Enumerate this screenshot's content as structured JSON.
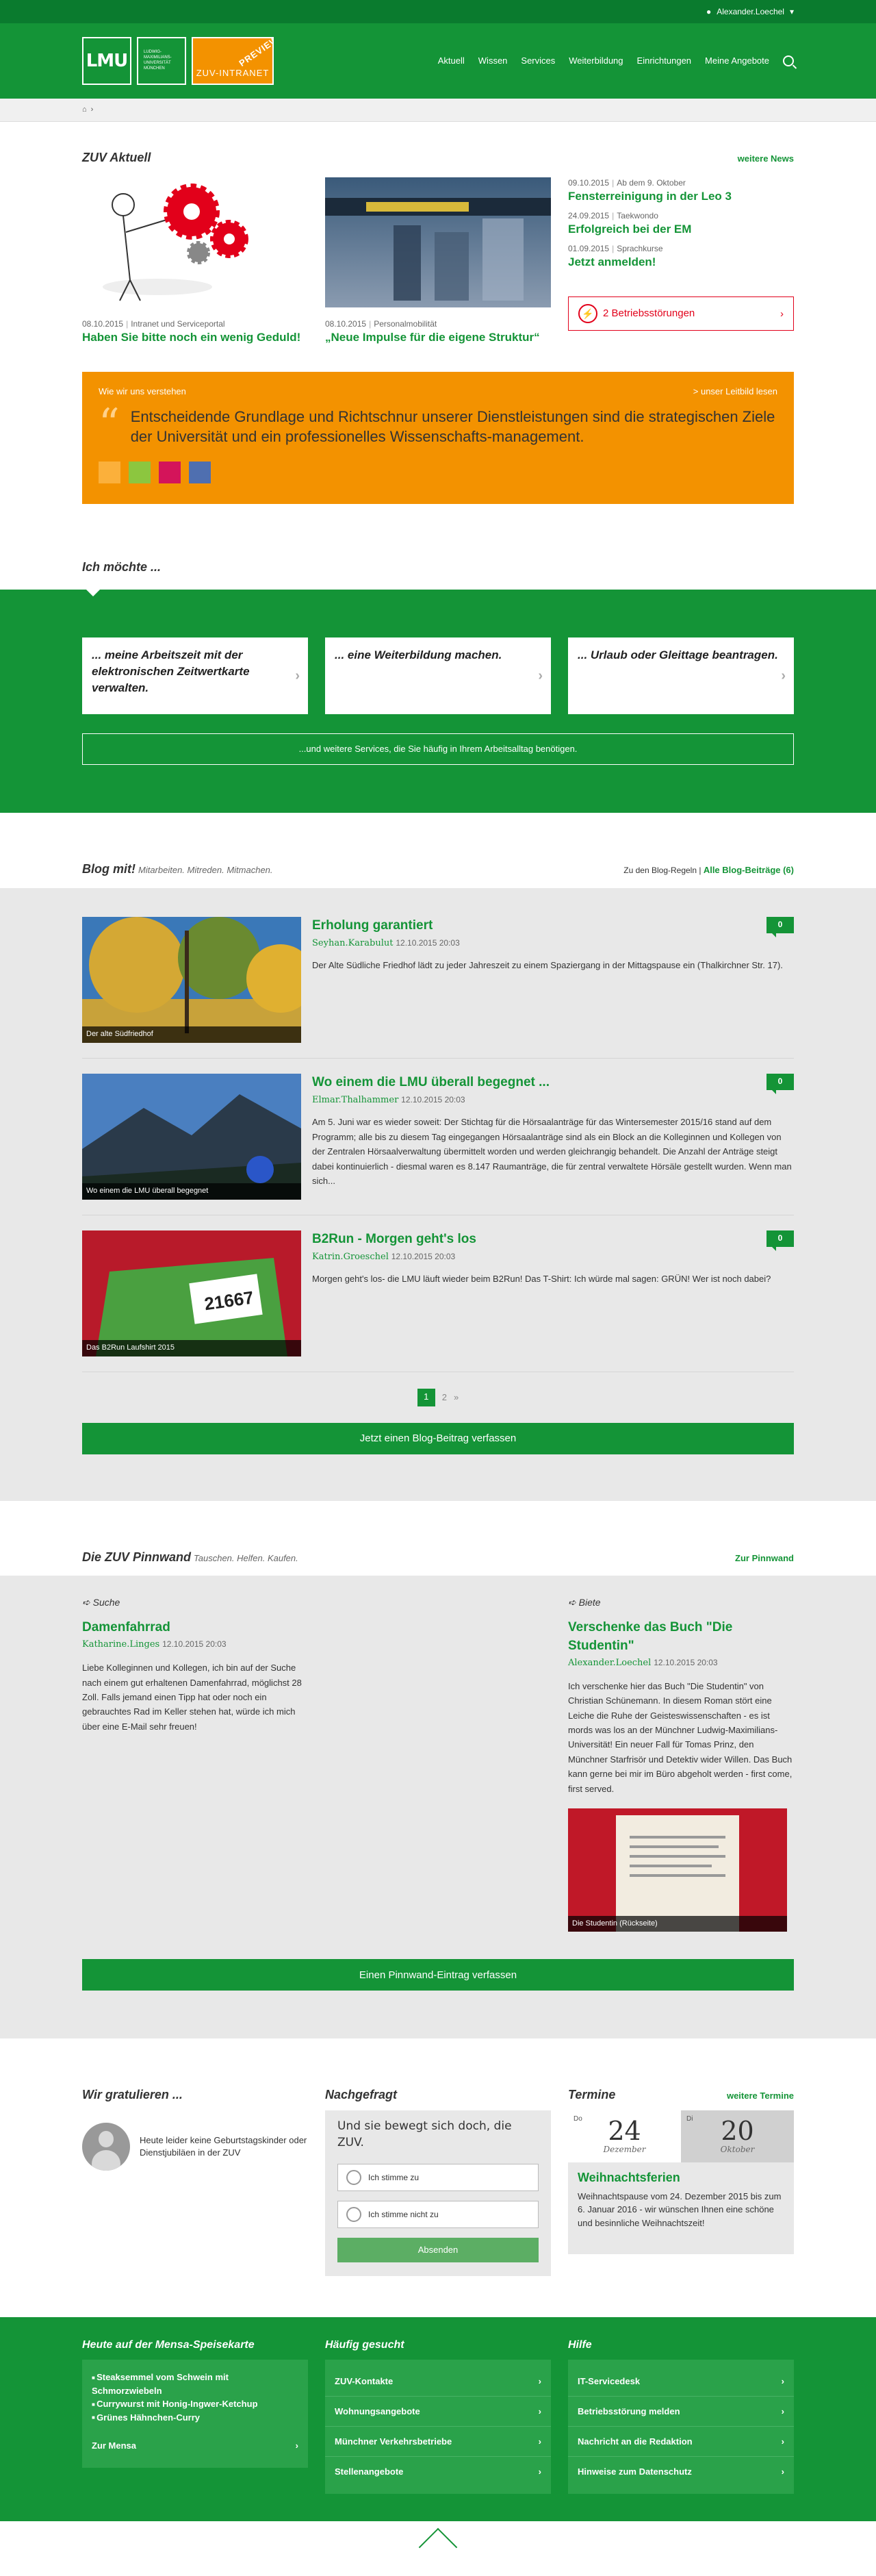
{
  "topbar": {
    "user": "Alexander.Loechel"
  },
  "header": {
    "logo": "LMU",
    "uni_lines": [
      "LUDWIG-",
      "MAXIMILIANS-",
      "UNIVERSITÄT",
      "MÜNCHEN"
    ],
    "zuv": "ZUV-INTRANET",
    "preview": "PREVIEW",
    "nav": [
      "Aktuell",
      "Wissen",
      "Services",
      "Weiterbildung",
      "Einrichtungen",
      "Meine Angebote"
    ]
  },
  "aktuell": {
    "title": "ZUV Aktuell",
    "more": "weitere News",
    "news": [
      {
        "date": "08.10.2015",
        "cat": "Intranet und Serviceportal",
        "title": "Haben Sie bitte noch ein wenig Geduld!"
      },
      {
        "date": "08.10.2015",
        "cat": "Personalmobilität",
        "title": "„Neue Impulse für die eigene Struktur“"
      }
    ],
    "list": [
      {
        "date": "09.10.2015",
        "cat": "Ab dem 9. Oktober",
        "title": "Fensterreinigung in der Leo 3"
      },
      {
        "date": "24.09.2015",
        "cat": "Taekwondo",
        "title": "Erfolgreich bei der EM"
      },
      {
        "date": "01.09.2015",
        "cat": "Sprachkurse",
        "title": "Jetzt anmelden!"
      }
    ],
    "alert": "2 Betriebsstörungen",
    "alert_icon": "lightning-icon"
  },
  "leitbild": {
    "label": "Wie wir uns verstehen",
    "link": "> unser Leitbild lesen",
    "text": "Entscheidende Grundlage und Richtschnur unserer Dienstleistungen sind die strategischen Ziele der Universität und ein professionelles Wissenschafts-management.",
    "colors": [
      "#fbb03b",
      "#8cc63f",
      "#d4145a",
      "#4f6fb0"
    ]
  },
  "ichmoechte": {
    "title": "Ich möchte ...",
    "cards": [
      "... meine Arbeitszeit mit der elektronischen Zeitwertkarte verwalten.",
      "... eine Weiterbildung machen.",
      "... Urlaub oder Gleittage beantragen."
    ],
    "more": "...und weitere Services, die Sie häufig in Ihrem Arbeitsalltag benötigen."
  },
  "blog": {
    "title": "Blog mit!",
    "subtitle": "Mitarbeiten. Mitreden. Mitmachen.",
    "rules": "Zu den Blog-Regeln",
    "all": "Alle Blog-Beiträge (6)",
    "posts": [
      {
        "title": "Erholung garantiert",
        "author": "Seyhan.Karabulut",
        "date": "12.10.2015 20:03",
        "text": "Der Alte Südliche Friedhof lädt zu jeder Jahreszeit zu einem Spaziergang in der Mittagspause ein (Thalkirchner Str. 17).",
        "caption": "Der alte Südfriedhof",
        "comments": "0"
      },
      {
        "title": "Wo einem die LMU überall begegnet ...",
        "author": "Elmar.Thalhammer",
        "date": "12.10.2015 20:03",
        "text": "Am 5. Juni war es wieder soweit: Der Stichtag für die Hörsaalanträge für das Wintersemester 2015/16 stand auf dem Programm; alle bis zu diesem Tag eingegangen Hörsaalanträge sind als ein Block an die Kolleginnen und Kollegen von der Zentralen Hörsaalverwaltung übermittelt worden und werden gleichrangig behandelt. Die Anzahl der Anträge steigt dabei kontinuierlich - diesmal waren es 8.147 Raumanträge, die für zentral verwaltete Hörsäle gestellt wurden. Wenn man sich...",
        "caption": "Wo einem die LMU überall begegnet",
        "comments": "0"
      },
      {
        "title": "B2Run - Morgen geht's los",
        "author": "Katrin.Groeschel",
        "date": "12.10.2015 20:03",
        "text": "Morgen geht's los- die LMU läuft wieder beim B2Run! Das T-Shirt: Ich würde mal sagen: GRÜN! Wer ist noch dabei?",
        "caption": "Das B2Run Laufshirt 2015",
        "comments": "0",
        "bib": "21667"
      }
    ],
    "pages": [
      "1",
      "2",
      "»"
    ],
    "write": "Jetzt einen Blog-Beitrag verfassen"
  },
  "pinnwand": {
    "title": "Die ZUV Pinnwand",
    "subtitle": "Tauschen. Helfen. Kaufen.",
    "link": "Zur Pinnwand",
    "items": [
      {
        "kind": "Suche",
        "title": "Damenfahrrad",
        "author": "Katharine.Linges",
        "date": "12.10.2015 20:03",
        "text": "Liebe Kolleginnen und Kollegen, ich bin auf der Suche nach einem gut erhaltenen Damenfahrrad, möglichst 28 Zoll. Falls jemand einen Tipp hat oder noch ein gebrauchtes Rad im Keller stehen hat, würde ich mich über eine E-Mail sehr freuen!"
      },
      {
        "kind": "Biete",
        "title": "Verschenke das Buch \"Die Studentin\"",
        "author": "Alexander.Loechel",
        "date": "12.10.2015 20:03",
        "text": "Ich verschenke hier das Buch \"Die Studentin\" von Christian Schünemann. In diesem Roman stört eine Leiche die Ruhe der Geisteswissenschaften - es ist mords was los an der Münchner Ludwig-Maximilians-Universität! Ein neuer Fall für Tomas Prinz, den Münchner Starfrisör und Detektiv wider Willen. Das Buch kann gerne bei mir im Büro abgeholt werden - first come, first served.",
        "caption": "Die Studentin (Rückseite)"
      }
    ],
    "write": "Einen Pinnwand-Eintrag verfassen"
  },
  "gratulieren": {
    "title": "Wir gratulieren ...",
    "text": "Heute leider keine Geburtstagskinder oder Dienstjubiläen in der ZUV"
  },
  "nachgefragt": {
    "title": "Nachgefragt",
    "question": "Und sie bewegt sich doch, die ZUV.",
    "options": [
      "Ich stimme zu",
      "Ich stimme nicht zu"
    ],
    "submit": "Absenden"
  },
  "termine": {
    "title": "Termine",
    "more": "weitere Termine",
    "start": {
      "wd": "Do",
      "day": "24",
      "month": "Dezember"
    },
    "end": {
      "wd": "Di",
      "day": "20",
      "month": "Oktober"
    },
    "event": "Weihnachtsferien",
    "text": "Weihnachtspause vom 24. Dezember 2015 bis zum 6. Januar 2016 - wir wünschen Ihnen eine schöne und besinnliche Weihnachtszeit!"
  },
  "footer": {
    "mensa": {
      "title": "Heute auf der Mensa-Speisekarte",
      "items": [
        "Steaksemmel vom Schwein mit Schmorzwiebeln",
        "Currywurst mit Honig-Ingwer-Ketchup",
        "Grünes Hähnchen-Curry"
      ],
      "link": "Zur Mensa"
    },
    "haeufig": {
      "title": "Häufig gesucht",
      "links": [
        "ZUV-Kontakte",
        "Wohnungsangebote",
        "Münchner Verkehrsbetriebe",
        "Stellenangebote"
      ]
    },
    "hilfe": {
      "title": "Hilfe",
      "links": [
        "IT-Servicedesk",
        "Betriebsstörung melden",
        "Nachricht an die Redaktion",
        "Hinweise zum Datenschutz"
      ]
    }
  }
}
